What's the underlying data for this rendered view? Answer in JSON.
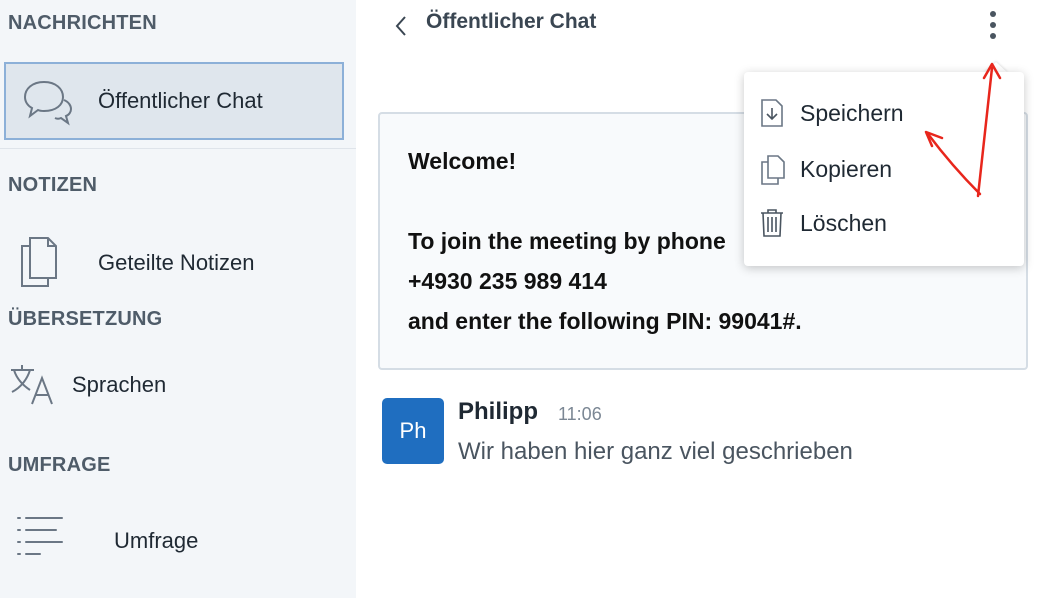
{
  "sidebar": {
    "sections": [
      {
        "title": "NACHRICHTEN",
        "item": {
          "label": "Öffentlicher Chat",
          "icon": "chat-bubbles-icon"
        }
      },
      {
        "title": "NOTIZEN",
        "item": {
          "label": "Geteilte Notizen",
          "icon": "documents-icon"
        }
      },
      {
        "title": "ÜBERSETZUNG",
        "item": {
          "label": "Sprachen",
          "icon": "translate-icon"
        }
      },
      {
        "title": "UMFRAGE",
        "item": {
          "label": "Umfrage",
          "icon": "list-icon"
        }
      }
    ]
  },
  "chat": {
    "title": "Öffentlicher Chat",
    "welcome": {
      "line1": "Welcome!",
      "line2": "To join the meeting by phone",
      "line3": "+4930 235 989 414",
      "line4": "and enter the following PIN: 99041#."
    },
    "message": {
      "avatar": "Ph",
      "author": "Philipp",
      "time": "11:06",
      "text": "Wir haben hier ganz viel geschrieben"
    }
  },
  "menu": {
    "items": [
      {
        "label": "Speichern",
        "icon": "download-icon"
      },
      {
        "label": "Kopieren",
        "icon": "copy-icon"
      },
      {
        "label": "Löschen",
        "icon": "trash-icon"
      }
    ]
  },
  "colors": {
    "sidebar_bg": "#f3f6f9",
    "active_border": "#8cb0d8",
    "avatar_bg": "#1f6ec0",
    "annotation": "#e8261c"
  }
}
